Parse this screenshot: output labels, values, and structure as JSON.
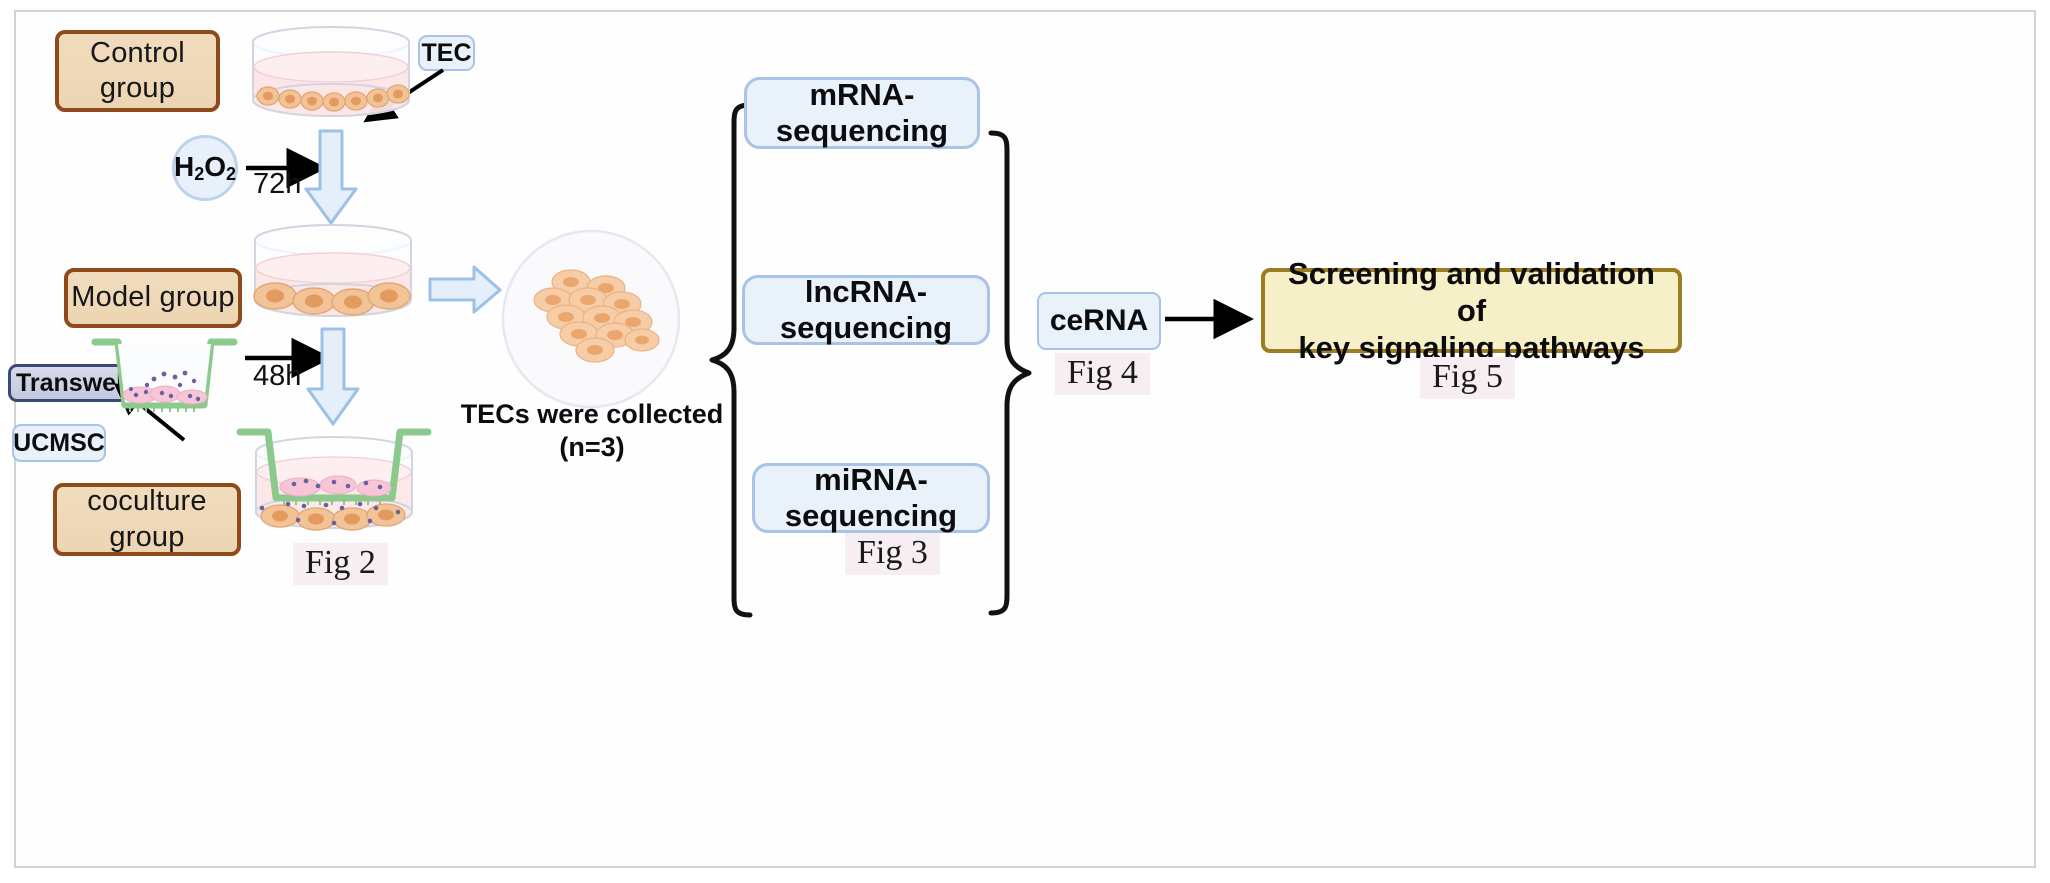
{
  "figure": {
    "type": "experimental-workflow-diagram",
    "colors": {
      "group_box_fill": "#ecd5b2",
      "group_box_border": "#8f4a1a",
      "blue_node_fill": "#e9f1fb",
      "blue_node_border": "#a8c3e6",
      "transwell_fill": "#c3c8de",
      "transwell_border": "#3b4a74",
      "final_box_fill": "#f6f0c8",
      "final_box_border": "#9c7d22",
      "caption_highlight": "#f7eef3",
      "arrow_black": "#000000",
      "block_arrow_fill": "#e5effa",
      "block_arrow_border": "#9cc0e6",
      "transwell_insert_green": "#8cc98c",
      "tec_cell_fill": "#f0bb84",
      "ucmsc_cell_fill": "#f3c2d4",
      "exosome_dot": "#6a5fa0",
      "medium_pink": "#f9dfe0",
      "frame_border": "#d2d2d4"
    },
    "groups": [
      {
        "id": "control",
        "label": "Control\ngroup",
        "line1": "Control",
        "line2": "group"
      },
      {
        "id": "model",
        "label": "Model group",
        "line1": "Model group",
        "line2": ""
      },
      {
        "id": "coculture",
        "label": "coculture\ngroup",
        "line1": "coculture",
        "line2": "group"
      }
    ],
    "annotations": {
      "tec_tag": "TEC",
      "transwell_tag": "Transwell",
      "ucmsc_tag": "UCMSC",
      "h2o2_label": "H",
      "h2o2_sub1": "2",
      "h2o2_mid": "O",
      "h2o2_sub2": "2",
      "h2o2_full": "H2O2",
      "duration_1": "72h",
      "duration_2": "48h",
      "collection_line1": "TECs were collected",
      "collection_line2": "(n=3)"
    },
    "sequencing": [
      {
        "id": "mrna",
        "line1": "mRNA-",
        "line2": "sequencing"
      },
      {
        "id": "lncrna",
        "line1": "lncRNA-",
        "line2": "sequencing"
      },
      {
        "id": "mirna",
        "line1": "miRNA-",
        "line2": "sequencing"
      }
    ],
    "cerna": {
      "label": "ceRNA"
    },
    "final_box": {
      "line1": "Screening and validation of",
      "line2": "key signaling pathways"
    },
    "captions": [
      {
        "id": "fig2",
        "text": "Fig 2"
      },
      {
        "id": "fig3",
        "text": "Fig 3"
      },
      {
        "id": "fig4",
        "text": "Fig 4"
      },
      {
        "id": "fig5",
        "text": "Fig 5"
      }
    ]
  }
}
